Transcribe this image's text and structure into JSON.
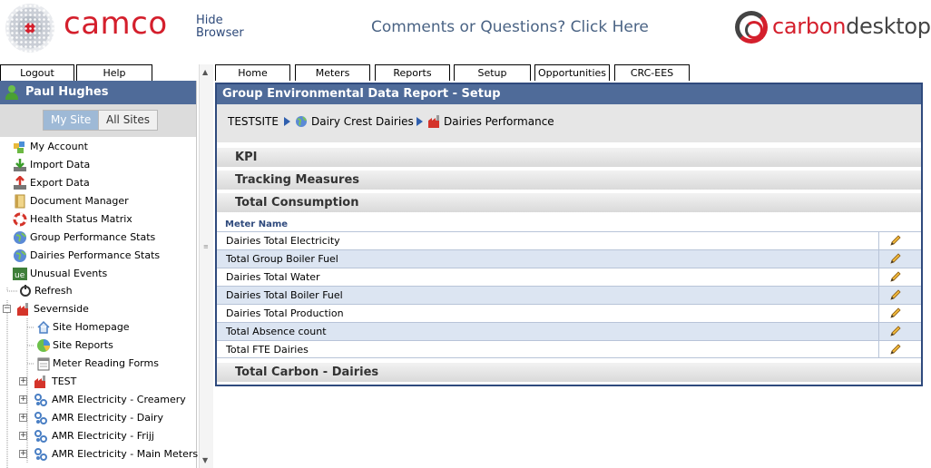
{
  "header": {
    "brand": "camco",
    "hide_browser": "Hide Browser",
    "comments": "Comments or Questions? Click Here",
    "cd_a": "carbon",
    "cd_b": "desktop"
  },
  "top_buttons": {
    "logout": "Logout",
    "help": "Help"
  },
  "tabs": [
    "Home",
    "Meters",
    "Reports",
    "Setup",
    "Opportunities",
    "CRC-EES"
  ],
  "user": "Paul Hughes",
  "site_toggle": {
    "my": "My Site",
    "all": "All Sites"
  },
  "nav": [
    "My Account",
    "Import Data",
    "Export Data",
    "Document Manager",
    "Health Status Matrix",
    "Group Performance Stats",
    "Dairies Performance Stats",
    "Unusual Events"
  ],
  "tree": {
    "refresh": "Refresh",
    "severnside": "Severnside",
    "site_home": "Site Homepage",
    "site_reports": "Site Reports",
    "meter_forms": "Meter Reading Forms",
    "test": "TEST",
    "amr1": "AMR Electricity - Creamery",
    "amr2": "AMR Electricity - Dairy",
    "amr3": "AMR Electricity - Frijj",
    "amr4": "AMR Electricity - Main Meters"
  },
  "panel": {
    "title": "Group Environmental Data Report - Setup",
    "crumb1": "TESTSITE",
    "crumb2": "Dairy Crest Dairies",
    "crumb3": "Dairies Performance"
  },
  "sections": {
    "kpi": "KPI",
    "tracking": "Tracking Measures",
    "total": "Total Consumption",
    "carbon": "Total Carbon - Dairies"
  },
  "meter_col": "Meter Name",
  "meters": [
    "Dairies Total Electricity",
    "Total Group Boiler Fuel",
    "Dairies Total Water",
    "Dairies Total Boiler Fuel",
    "Dairies Total Production",
    "Total Absence count",
    "Total FTE Dairies"
  ],
  "colors": {
    "accent": "#4f6b99",
    "border": "#2f4a7d",
    "brand_red": "#d41f2c"
  }
}
